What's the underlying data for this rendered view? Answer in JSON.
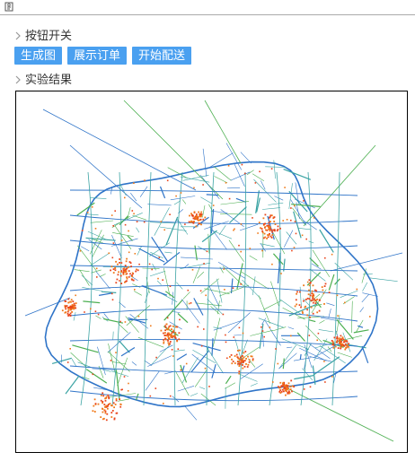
{
  "toggle_section": {
    "label": "按钮开关"
  },
  "buttons": [
    {
      "label": "生成图"
    },
    {
      "label": "展示订单"
    },
    {
      "label": "开始配送"
    }
  ],
  "result_section": {
    "label": "实验结果"
  },
  "map": {
    "road_colors": [
      "#2f74c8",
      "#4caf50",
      "#3aa3a3"
    ],
    "point_colors": [
      "#e8441c",
      "#f07a1a"
    ]
  }
}
